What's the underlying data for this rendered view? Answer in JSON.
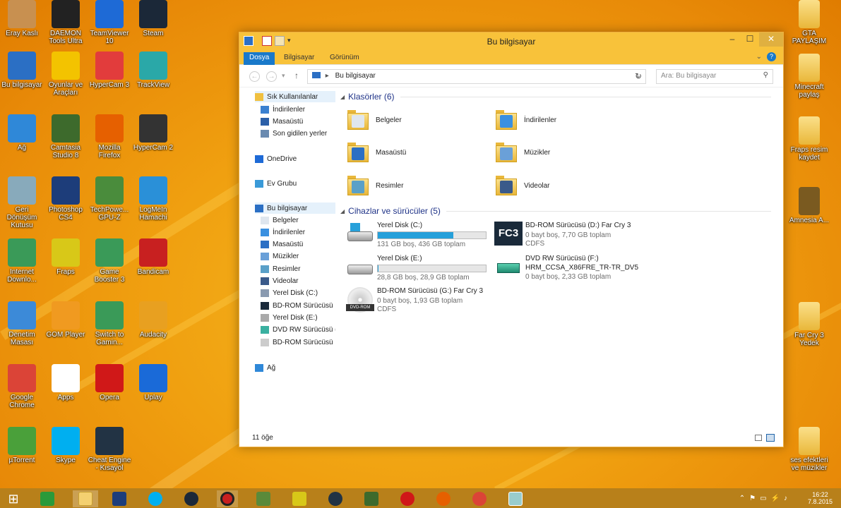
{
  "desktop": {
    "icons": [
      {
        "label": "Eray Kaslı",
        "color": "#c89050"
      },
      {
        "label": "DAEMON Tools Ultra",
        "color": "#222"
      },
      {
        "label": "TeamViewer 10",
        "color": "#1e6ad6"
      },
      {
        "label": "Steam",
        "color": "#1b2838"
      },
      {
        "label": "Bu bilgisayar",
        "color": "#2b6fc4"
      },
      {
        "label": "Oyunlar ve Araçları",
        "color": "#f3c300"
      },
      {
        "label": "HyperCam 3",
        "color": "#e23c3c"
      },
      {
        "label": "TrackView",
        "color": "#2aa8a8"
      },
      {
        "label": "Ağ",
        "color": "#2f88d8"
      },
      {
        "label": "Camtasia Studio 8",
        "color": "#3d6a2c"
      },
      {
        "label": "Mozilla Firefox",
        "color": "#e66000"
      },
      {
        "label": "HyperCam 2",
        "color": "#333"
      },
      {
        "label": "Geri Dönüşüm Kutusu",
        "color": "#8ab"
      },
      {
        "label": "Photoshop CS4",
        "color": "#1d3d7a"
      },
      {
        "label": "TechPowe... GPU-Z",
        "color": "#4a8c3c"
      },
      {
        "label": "LogMeIn Hamachi",
        "color": "#2a90d8"
      },
      {
        "label": "Internet Downlo...",
        "color": "#3a9a58"
      },
      {
        "label": "Fraps",
        "color": "#d8c818"
      },
      {
        "label": "Game Booster 3",
        "color": "#3a9a58"
      },
      {
        "label": "Bandicam",
        "color": "#c82020"
      },
      {
        "label": "Denetim Masası",
        "color": "#3c8ad8"
      },
      {
        "label": "GOM Player",
        "color": "#f09a20"
      },
      {
        "label": "Switch to Gamin...",
        "color": "#3a9a58"
      },
      {
        "label": "Audacity",
        "color": "#e8a020"
      },
      {
        "label": "Google Chrome",
        "color": "#db4437"
      },
      {
        "label": "Apps",
        "color": "#fff"
      },
      {
        "label": "Opera",
        "color": "#d01818"
      },
      {
        "label": "Uplay",
        "color": "#1a6ad8"
      },
      {
        "label": "µTorrent",
        "color": "#4aa03a"
      },
      {
        "label": "Skype",
        "color": "#00aff0"
      },
      {
        "label": "Cheat Engine - Kısayol",
        "color": "#234"
      }
    ],
    "right_icons": [
      {
        "label": "GTA PAYLAŞIM"
      },
      {
        "label": "Minecraft paylaş"
      },
      {
        "label": "Fraps resim kaydet"
      },
      {
        "label": "Amnesia A..."
      },
      {
        "label": "Far Cry 3 Yedek"
      },
      {
        "label": "ses efektleri ve müzikler"
      }
    ]
  },
  "window": {
    "title": "Bu bilgisayar",
    "ribbon_tabs": [
      "Dosya",
      "Bilgisayar",
      "Görünüm"
    ],
    "address": "Bu bilgisayar",
    "search_placeholder": "Ara: Bu bilgisayar",
    "nav": {
      "quick_access": "Sık Kullanılanlar",
      "quick_items": [
        "İndirilenler",
        "Masaüstü",
        "Son gidilen yerler"
      ],
      "onedrive": "OneDrive",
      "homegroup": "Ev Grubu",
      "thispc": "Bu bilgisayar",
      "pc_items": [
        "Belgeler",
        "İndirilenler",
        "Masaüstü",
        "Müzikler",
        "Resimler",
        "Videolar",
        "Yerel Disk (C:)",
        "BD-ROM Sürücüsü (",
        "Yerel Disk (E:)",
        "DVD RW Sürücüsü (F",
        "BD-ROM Sürücüsü ("
      ],
      "network": "Ağ"
    },
    "folders_header": "Klasörler (6)",
    "folders": [
      {
        "name": "Belgeler",
        "overlay": "#dfe6ee"
      },
      {
        "name": "İndirilenler",
        "overlay": "#3a90e0"
      },
      {
        "name": "Masaüstü",
        "overlay": "#2b6fc4"
      },
      {
        "name": "Müzikler",
        "overlay": "#6aa0d8"
      },
      {
        "name": "Resimler",
        "overlay": "#5aa0c8"
      },
      {
        "name": "Videolar",
        "overlay": "#3a5a8a"
      }
    ],
    "drives_header": "Cihazlar ve sürücüler (5)",
    "drives": [
      {
        "name": "Yerel Disk (C:)",
        "free": "131 GB boş, 436 GB toplam",
        "fill": 0.7,
        "fs": ""
      },
      {
        "name": "BD-ROM Sürücüsü (D:) Far Cry 3",
        "free": "0 bayt boş, 7,70 GB toplam",
        "fs": "CDFS"
      },
      {
        "name": "Yerel Disk (E:)",
        "free": "28,8 GB boş, 28,9 GB toplam",
        "fill": 0.003,
        "fs": ""
      },
      {
        "name": "DVD RW Sürücüsü (F:)",
        "name2": "HRM_CCSA_X86FRE_TR-TR_DV5",
        "free": "0 bayt boş, 2,33 GB toplam",
        "fs": ""
      },
      {
        "name": "BD-ROM Sürücüsü (G:) Far Cry 3",
        "free": "0 bayt boş, 1,93 GB toplam",
        "fs": "CDFS"
      }
    ],
    "status": "11 öğe",
    "fc3_label": "FC3",
    "dvd_label": "DVD-ROM"
  },
  "taskbar": {
    "time": "16:22",
    "date": "7.8.2015"
  }
}
